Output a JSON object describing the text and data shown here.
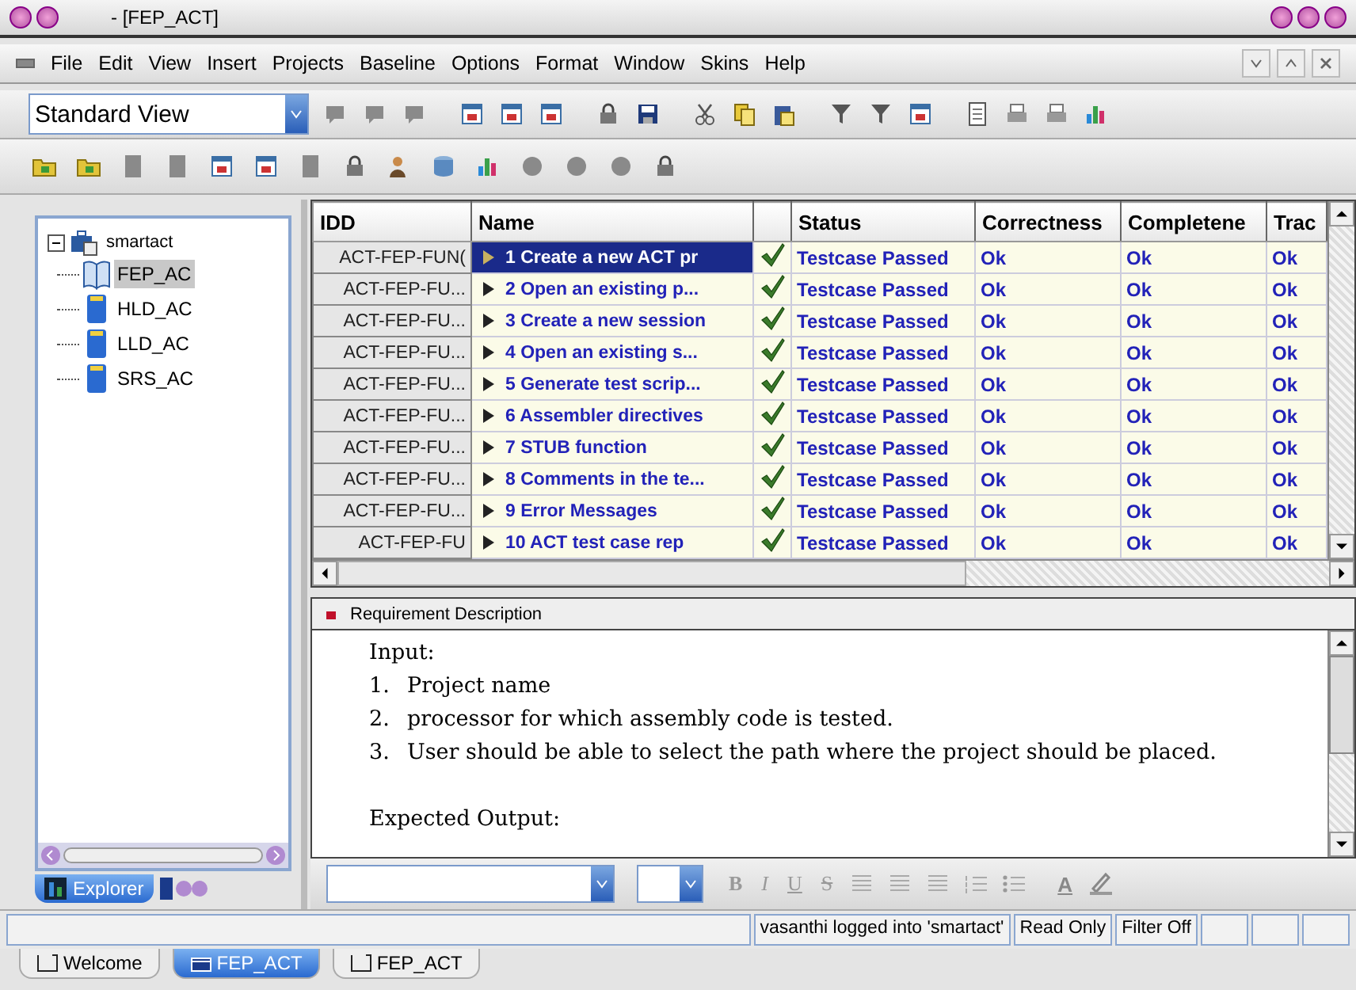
{
  "window": {
    "title": "- [FEP_ACT]"
  },
  "menu": [
    "File",
    "Edit",
    "View",
    "Insert",
    "Projects",
    "Baseline",
    "Options",
    "Format",
    "Window",
    "Skins",
    "Help"
  ],
  "view_select": {
    "value": "Standard View"
  },
  "tree": {
    "label": "smartact",
    "expanded": true,
    "children": [
      {
        "label": "FEP_AC",
        "selected": true,
        "kind": "book"
      },
      {
        "label": "HLD_AC",
        "selected": false,
        "kind": "doc"
      },
      {
        "label": "LLD_AC",
        "selected": false,
        "kind": "doc"
      },
      {
        "label": "SRS_AC",
        "selected": false,
        "kind": "doc"
      }
    ]
  },
  "side_tabs": [
    {
      "label": "Explorer",
      "selected": true
    }
  ],
  "table": {
    "columns": [
      "IDD",
      "Name",
      "Status",
      "Correctness",
      "Completene",
      "Trac"
    ],
    "rows": [
      {
        "idd": "ACT-FEP-FUN(",
        "name": "1 Create a new ACT pr",
        "passed": true,
        "status": "Testcase Passed",
        "correctness": "Ok",
        "completeness": "Ok",
        "trac": "Ok",
        "selected": true
      },
      {
        "idd": "ACT-FEP-FU...",
        "name": "2 Open an existing p...",
        "passed": true,
        "status": "Testcase Passed",
        "correctness": "Ok",
        "completeness": "Ok",
        "trac": "Ok",
        "selected": false
      },
      {
        "idd": "ACT-FEP-FU...",
        "name": "3 Create a new session",
        "passed": true,
        "status": "Testcase Passed",
        "correctness": "Ok",
        "completeness": "Ok",
        "trac": "Ok",
        "selected": false
      },
      {
        "idd": "ACT-FEP-FU...",
        "name": "4 Open an existing s...",
        "passed": true,
        "status": "Testcase Passed",
        "correctness": "Ok",
        "completeness": "Ok",
        "trac": "Ok",
        "selected": false
      },
      {
        "idd": "ACT-FEP-FU...",
        "name": "5 Generate test scrip...",
        "passed": true,
        "status": "Testcase Passed",
        "correctness": "Ok",
        "completeness": "Ok",
        "trac": "Ok",
        "selected": false
      },
      {
        "idd": "ACT-FEP-FU...",
        "name": "6 Assembler directives",
        "passed": true,
        "status": "Testcase Passed",
        "correctness": "Ok",
        "completeness": "Ok",
        "trac": "Ok",
        "selected": false
      },
      {
        "idd": "ACT-FEP-FU...",
        "name": "7 STUB function",
        "passed": true,
        "status": "Testcase Passed",
        "correctness": "Ok",
        "completeness": "Ok",
        "trac": "Ok",
        "selected": false
      },
      {
        "idd": "ACT-FEP-FU...",
        "name": "8 Comments in the te...",
        "passed": true,
        "status": "Testcase Passed",
        "correctness": "Ok",
        "completeness": "Ok",
        "trac": "Ok",
        "selected": false
      },
      {
        "idd": "ACT-FEP-FU...",
        "name": "9 Error Messages",
        "passed": true,
        "status": "Testcase Passed",
        "correctness": "Ok",
        "completeness": "Ok",
        "trac": "Ok",
        "selected": false
      },
      {
        "idd": "ACT-FEP-FU",
        "name": "10 ACT test case rep",
        "passed": true,
        "status": "Testcase Passed",
        "correctness": "Ok",
        "completeness": "Ok",
        "trac": "Ok",
        "selected": false
      }
    ]
  },
  "description": {
    "title": "Requirement Description",
    "lines": [
      {
        "kind": "heading",
        "text": "Input:"
      },
      {
        "kind": "item",
        "number": "1.",
        "text": "Project name"
      },
      {
        "kind": "item",
        "number": "2.",
        "text": "processor for which assembly code is tested."
      },
      {
        "kind": "item",
        "number": "3.",
        "text": "User should be able to select the path where the project should be placed."
      },
      {
        "kind": "heading",
        "text": "Expected Output:"
      }
    ]
  },
  "format_buttons": [
    "B",
    "I",
    "U",
    "S"
  ],
  "font_color_button": "A",
  "status_bar": [
    "vasanthi logged into 'smartact'",
    "Read Only",
    "Filter Off"
  ],
  "doc_tabs": [
    {
      "label": "Welcome",
      "selected": false
    },
    {
      "label": "FEP_ACT",
      "selected": true
    },
    {
      "label": "FEP_ACT",
      "selected": false
    }
  ]
}
